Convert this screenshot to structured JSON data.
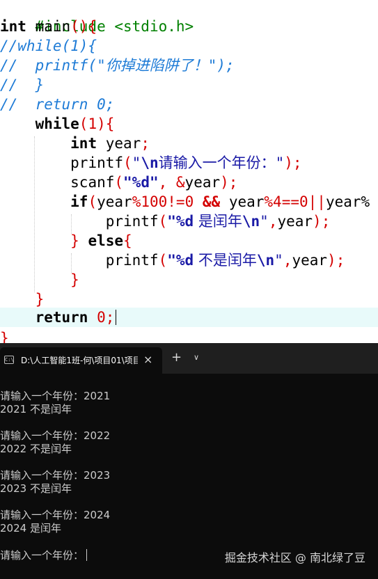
{
  "editor": {
    "code": {
      "l1_pp": "#include <stdio.h>",
      "l2_kw": "int",
      "l2_fn": " main",
      "l2_op": "(){",
      "l3_cmt": "//while(1){",
      "l4_cmt_a": "//  printf(\"",
      "l4_cmt_cn": "你掉进陷阱了！",
      "l4_cmt_b": "\");",
      "l5_cmt": "//  }",
      "l6_cmt": "//  return 0;",
      "l7_kw": "while",
      "l7_op1": "(",
      "l7_num": "1",
      "l7_op2": "){",
      "l8_kw": "int",
      "l8_id": " year",
      "l8_op": ";",
      "l9_fn": "printf",
      "l9_op1": "(",
      "l9_str1": "\"",
      "l9_esc": "\\n",
      "l9_cn": "请输入一个年份：",
      "l9_str2": "\"",
      "l9_op2": ");",
      "l10_fn": "scanf",
      "l10_op1": "(",
      "l10_str": "\"%d\"",
      "l10_op2": ", &",
      "l10_id": "year",
      "l10_op3": ");",
      "l11_kw": "if",
      "l11_op1": "(",
      "l11_id1": "year",
      "l11_op2": "%",
      "l11_num1": "100",
      "l11_op3": "!=",
      "l11_num2": "0",
      "l11_op4": " && ",
      "l11_id2": "year",
      "l11_op5": "%",
      "l11_num3": "4",
      "l11_op6": "==",
      "l11_num4": "0",
      "l11_op7": "||",
      "l11_id3": "year%",
      "l12_fn": "printf",
      "l12_op1": "(",
      "l12_fmt": "\"%d",
      "l12_cn": " 是闰年",
      "l12_esc": "\\n",
      "l12_str": "\"",
      "l12_op2": ",",
      "l12_id": "year",
      "l12_op3": ");",
      "l13_op1": "}",
      "l13_kw": " else",
      "l13_op2": "{",
      "l14_fn": "printf",
      "l14_op1": "(",
      "l14_fmt": "\"%d",
      "l14_cn": " 不是闰年",
      "l14_esc": "\\n",
      "l14_str": "\"",
      "l14_op2": ",",
      "l14_id": "year",
      "l14_op3": ");",
      "l15_op": "}",
      "l16_op": "}",
      "l17_kw": "return",
      "l17_num": " 0",
      "l17_op": ";",
      "l18_op": "}"
    }
  },
  "terminal": {
    "tab_icon": "C:\\",
    "tab_title": "D:\\人工智能1班-何\\项目01\\项目",
    "close_glyph": "×",
    "new_tab_glyph": "+",
    "dropdown_glyph": "∨",
    "lines": [
      "请输入一个年份：2021",
      "2021 不是闰年",
      "请输入一个年份：2022",
      "2022 不是闰年",
      "请输入一个年份：2023",
      "2023 不是闰年",
      "请输入一个年份：2024",
      "2024 是闰年",
      "请输入一个年份："
    ],
    "watermark": "掘金技术社区 @ 南北绿了豆"
  },
  "icons": {
    "terminal_tab_icon": "terminal-icon",
    "close": "close-icon",
    "new_tab": "plus-icon",
    "dropdown": "chevron-down-icon"
  }
}
